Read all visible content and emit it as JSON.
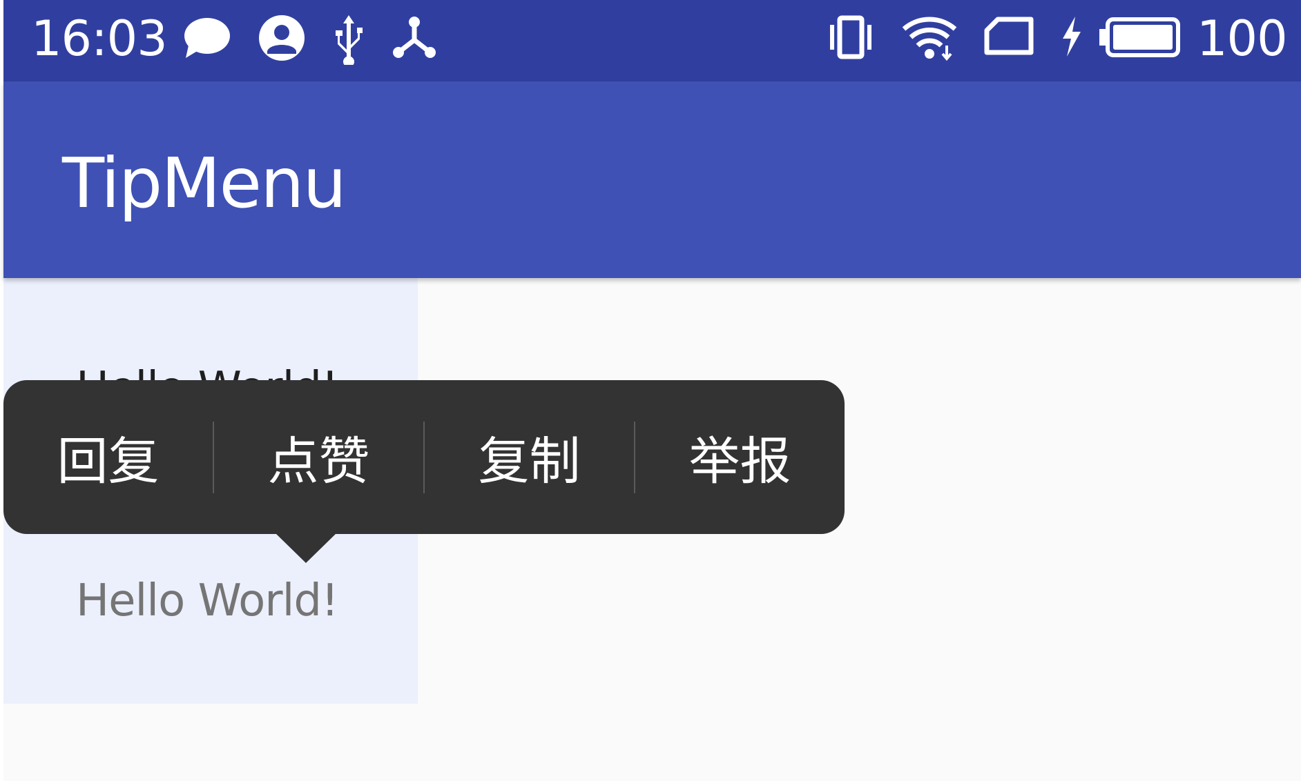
{
  "status_bar": {
    "time": "16:03",
    "battery_level": "100",
    "icons_left": [
      "message-icon",
      "account-icon",
      "usb-icon",
      "network-share-icon"
    ],
    "icons_right": [
      "vibrate-icon",
      "wifi-icon",
      "sim-card-icon",
      "charging-icon",
      "battery-icon"
    ],
    "background": "#303F9F"
  },
  "app_bar": {
    "title": "TipMenu",
    "background": "#3F51B5"
  },
  "content": {
    "background": "#FAFAFA",
    "highlight_background": "#ECF0FC",
    "hello_text_1": "Hello World!",
    "hello_text_2": "Hello World!"
  },
  "tip_menu": {
    "background": "#333333",
    "items": [
      {
        "label": "回复"
      },
      {
        "label": "点赞"
      },
      {
        "label": "复制"
      },
      {
        "label": "举报"
      }
    ]
  }
}
